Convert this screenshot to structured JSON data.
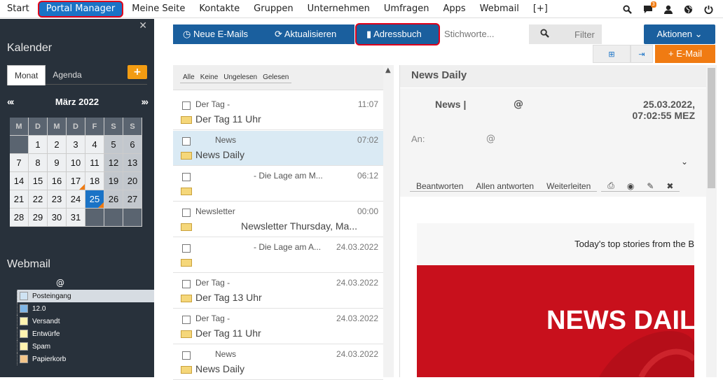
{
  "topnav": {
    "items": [
      "Start",
      "Portal Manager",
      "Meine Seite",
      "Kontakte",
      "Gruppen",
      "Unternehmen",
      "Umfragen",
      "Apps",
      "Webmail",
      "[+]"
    ],
    "notifications_count": "3"
  },
  "sidebar": {
    "calendar_title": "Kalender",
    "tabs": [
      "Monat",
      "Agenda"
    ],
    "plus_label": "+",
    "month_label": "März 2022",
    "prev_label": "«‹",
    "next_label": "›»",
    "weekdays": [
      "M",
      "D",
      "M",
      "D",
      "F",
      "S",
      "S"
    ],
    "weeks": [
      [
        "",
        "1",
        "2",
        "3",
        "4",
        "5",
        "6"
      ],
      [
        "7",
        "8",
        "9",
        "10",
        "11",
        "12",
        "13"
      ],
      [
        "14",
        "15",
        "16",
        "17",
        "18",
        "19",
        "20"
      ],
      [
        "21",
        "22",
        "23",
        "24",
        "25",
        "26",
        "27"
      ],
      [
        "28",
        "29",
        "30",
        "31",
        "",
        "",
        ""
      ]
    ],
    "today": "25",
    "marked_days": [
      "17",
      "25"
    ],
    "webmail_title": "Webmail",
    "account_label": "@",
    "folders": [
      "Posteingang",
      "12.0",
      "Versandt",
      "Entwürfe",
      "Spam",
      "Papierkorb"
    ]
  },
  "toolbar": {
    "new_mails": "Neue E-Mails",
    "refresh": "Aktualisieren",
    "addressbook": "Adressbuch",
    "search_placeholder": "Stichworte...",
    "filter": "Filter",
    "aktionen": "Aktionen",
    "email_btn": "E-Mail"
  },
  "list": {
    "filters": [
      "Alle",
      "Keine",
      "Ungelesen",
      "Gelesen"
    ],
    "messages": [
      {
        "sender": "Der Tag -",
        "subject": "Der Tag 11 Uhr",
        "time": "11:07"
      },
      {
        "sender": "News",
        "subject": "News Daily",
        "time": "07:02"
      },
      {
        "sender": "- Die Lage am M...",
        "subject": "",
        "time": "06:12"
      },
      {
        "sender": "Newsletter",
        "subject": "Newsletter Thursday, Ma...",
        "time": "00:00"
      },
      {
        "sender": "- Die Lage am A...",
        "subject": "",
        "time": "24.03.2022"
      },
      {
        "sender": "Der Tag -",
        "subject": "Der Tag 13 Uhr",
        "time": "24.03.2022"
      },
      {
        "sender": "Der Tag -",
        "subject": "Der Tag 11 Uhr",
        "time": "24.03.2022"
      },
      {
        "sender": "News",
        "subject": "News Daily",
        "time": "24.03.2022"
      }
    ]
  },
  "reader": {
    "title": "News Daily",
    "from": "News |",
    "from_at": "@",
    "date": "25.03.2022,",
    "time": "07:02:55 MEZ",
    "to_label": "An:",
    "to_at": "@",
    "actions": [
      "Beantworten",
      "Allen antworten",
      "Weiterleiten"
    ],
    "body_intro": "Today's top stories from the B",
    "banner_text": "NEWS DAIL"
  }
}
